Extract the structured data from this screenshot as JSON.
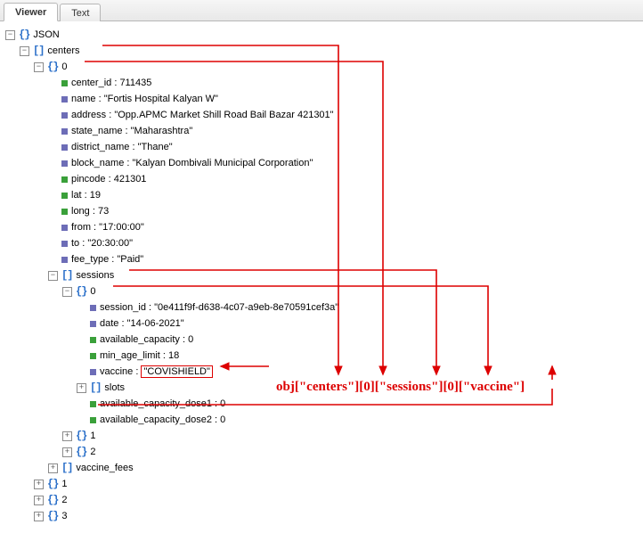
{
  "tabs": {
    "viewer": "Viewer",
    "text": "Text"
  },
  "root": "JSON",
  "centers_key": "centers",
  "idx0": "0",
  "idx1": "1",
  "idx2": "2",
  "idx3": "3",
  "center": {
    "center_id": {
      "k": "center_id",
      "v": "711435"
    },
    "name": {
      "k": "name",
      "v": "\"Fortis Hospital Kalyan W\""
    },
    "address": {
      "k": "address",
      "v": "\"Opp.APMC Market Shill Road Bail Bazar 421301\""
    },
    "state_name": {
      "k": "state_name",
      "v": "\"Maharashtra\""
    },
    "district_name": {
      "k": "district_name",
      "v": "\"Thane\""
    },
    "block_name": {
      "k": "block_name",
      "v": "\"Kalyan Dombivali Municipal Corporation\""
    },
    "pincode": {
      "k": "pincode",
      "v": "421301"
    },
    "lat": {
      "k": "lat",
      "v": "19"
    },
    "long": {
      "k": "long",
      "v": "73"
    },
    "from": {
      "k": "from",
      "v": "\"17:00:00\""
    },
    "to": {
      "k": "to",
      "v": "\"20:30:00\""
    },
    "fee_type": {
      "k": "fee_type",
      "v": "\"Paid\""
    }
  },
  "sessions_key": "sessions",
  "session": {
    "session_id": {
      "k": "session_id",
      "v": "\"0e411f9f-d638-4c07-a9eb-8e70591cef3a\""
    },
    "date": {
      "k": "date",
      "v": "\"14-06-2021\""
    },
    "available_capacity": {
      "k": "available_capacity",
      "v": "0"
    },
    "min_age_limit": {
      "k": "min_age_limit",
      "v": "18"
    },
    "vaccine": {
      "k": "vaccine",
      "v": "\"COVISHIELD\""
    },
    "slots": "slots",
    "available_capacity_dose1": {
      "k": "available_capacity_dose1",
      "v": "0"
    },
    "available_capacity_dose2": {
      "k": "available_capacity_dose2",
      "v": "0"
    }
  },
  "vaccine_fees_key": "vaccine_fees",
  "annotation": "obj[\"centers\"][0][\"sessions\"][0][\"vaccine\"]"
}
